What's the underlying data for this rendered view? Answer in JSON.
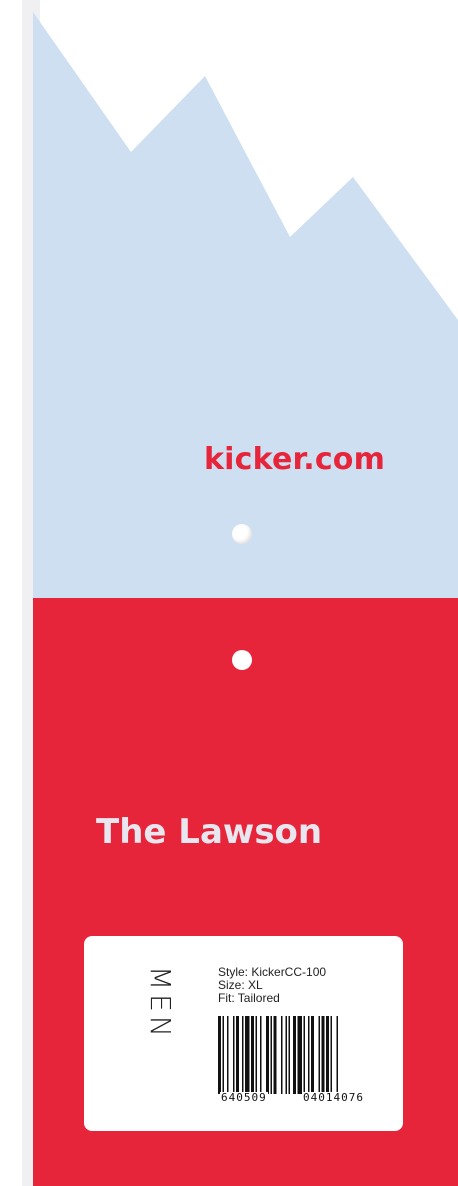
{
  "tag": {
    "colors": {
      "sky": "#cddff0",
      "brand_red": "#e6253a",
      "name_text": "#e8e6ef",
      "shadow": "#f0f0f2"
    },
    "website": "kicker.com",
    "product_name": "The Lawson"
  },
  "label": {
    "gender": "MEN",
    "style": "Style: KickerCC-100",
    "size": "Size: XL",
    "fit": "Fit: Tailored",
    "barcode_left": "640509",
    "barcode_right": "04014076"
  }
}
